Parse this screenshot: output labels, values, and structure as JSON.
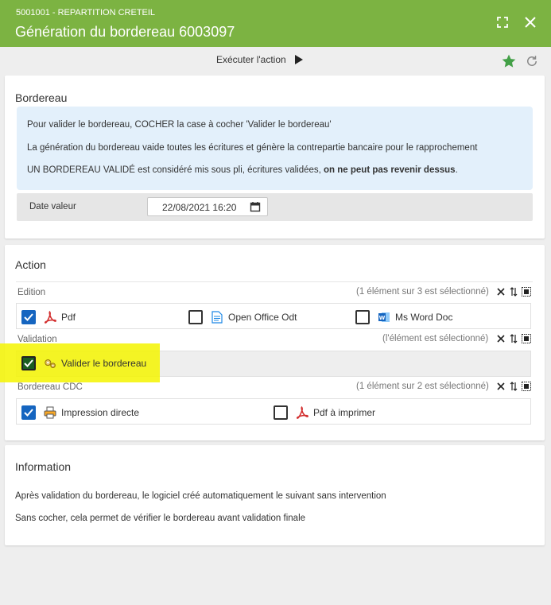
{
  "header": {
    "subtitle": "5001001 - REPARTITION CRETEIL",
    "title": "Génération du bordereau 6003097",
    "icons": {
      "fullscreen": "fullscreen-icon",
      "close": "close-icon"
    }
  },
  "toolbar": {
    "execute_label": "Exécuter l'action",
    "icons": {
      "play": "play-icon",
      "favorite": "star-icon",
      "refresh": "refresh-icon"
    }
  },
  "bordereau": {
    "title": "Bordereau",
    "info_lines": {
      "line1": "Pour valider le bordereau, COCHER la case à cocher 'Valider le bordereau'",
      "line2": "La génération du bordereau vaide toutes les écritures et génère la contrepartie bancaire pour le rapprochement",
      "line3_prefix": "UN BORDEREAU VALIDÉ est considéré mis sous pli, écritures validées, ",
      "line3_bold": "on ne peut pas revenir dessus",
      "line3_suffix": "."
    },
    "date_label": "Date valeur",
    "date_value": "22/08/2021 16:20"
  },
  "action": {
    "title": "Action",
    "groups": [
      {
        "label": "Edition",
        "status": "(1 élément sur 3 est sélectionné)",
        "options": [
          {
            "label": "Pdf",
            "checked": true,
            "icon": "pdf-icon"
          },
          {
            "label": "Open Office Odt",
            "checked": false,
            "icon": "document-icon"
          },
          {
            "label": "Ms Word Doc",
            "checked": false,
            "icon": "word-icon"
          }
        ]
      },
      {
        "label": "Validation",
        "status": "(l'élément est sélectionné)",
        "options": [
          {
            "label": "Valider le bordereau",
            "checked": true,
            "icon": "gears-icon"
          }
        ]
      },
      {
        "label": "Bordereau CDC",
        "status": "(1 élément sur 2 est sélectionné)",
        "options": [
          {
            "label": "Impression directe",
            "checked": true,
            "icon": "printer-icon"
          },
          {
            "label": "Pdf à imprimer",
            "checked": false,
            "icon": "pdf-icon"
          }
        ]
      }
    ],
    "group_icons": {
      "clear": "clear-icon",
      "sort": "sort-icon",
      "select_all": "select-all-icon"
    }
  },
  "information": {
    "title": "Information",
    "line1": "Après validation du bordereau, le logiciel créé automatiquement le suivant sans intervention",
    "line2": "Sans cocher, cela permet de vérifier le bordereau avant validation finale"
  },
  "colors": {
    "header_green": "#7cb342",
    "checkbox_blue": "#1565c0",
    "highlight_yellow": "#f5f500",
    "info_blue": "#e3f0fb",
    "star_green": "#43a047"
  }
}
